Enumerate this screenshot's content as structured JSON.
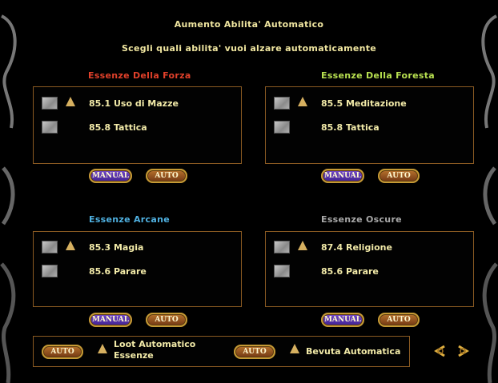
{
  "header": {
    "title": "Aumento Abilita' Automatico",
    "subtitle": "Scegli quali abilita' vuoi alzare automaticamente"
  },
  "sections": [
    {
      "name": "Essenze Della Forza",
      "color": "#e0402a",
      "skills": [
        {
          "label": "85.1 Uso di Mazze",
          "arrow": true
        },
        {
          "label": "85.8 Tattica",
          "arrow": false
        }
      ],
      "manual": "MANUAL",
      "auto": "AUTO"
    },
    {
      "name": "Essenze Della Foresta",
      "color": "#b8e050",
      "skills": [
        {
          "label": "85.5 Meditazione",
          "arrow": true
        },
        {
          "label": "85.8 Tattica",
          "arrow": false
        }
      ],
      "manual": "MANUAL",
      "auto": "AUTO"
    },
    {
      "name": "Essenze Arcane",
      "color": "#4fb0e0",
      "skills": [
        {
          "label": "85.3 Magia",
          "arrow": true
        },
        {
          "label": "85.6 Parare",
          "arrow": false
        }
      ],
      "manual": "MANUAL",
      "auto": "AUTO"
    },
    {
      "name": "Essenze Oscure",
      "color": "#a8a8a8",
      "skills": [
        {
          "label": "87.4 Religione",
          "arrow": true
        },
        {
          "label": "85.6 Parare",
          "arrow": false
        }
      ],
      "manual": "MANUAL",
      "auto": "AUTO"
    }
  ],
  "footer": {
    "loot_button": "AUTO",
    "loot_label_1": "Loot Automatico",
    "loot_label_2": "Essenze",
    "drink_button": "AUTO",
    "drink_label": "Bevuta Automatica"
  },
  "colors": {
    "panel_border": "#8a5a22",
    "text": "#f0e6a0"
  },
  "icons": {
    "checkbox": "checkbox-icon",
    "arrow": "raise-arrow-icon",
    "dragon": "dragon-ornament-icon",
    "nav": "triquetra-arrow-icon"
  }
}
